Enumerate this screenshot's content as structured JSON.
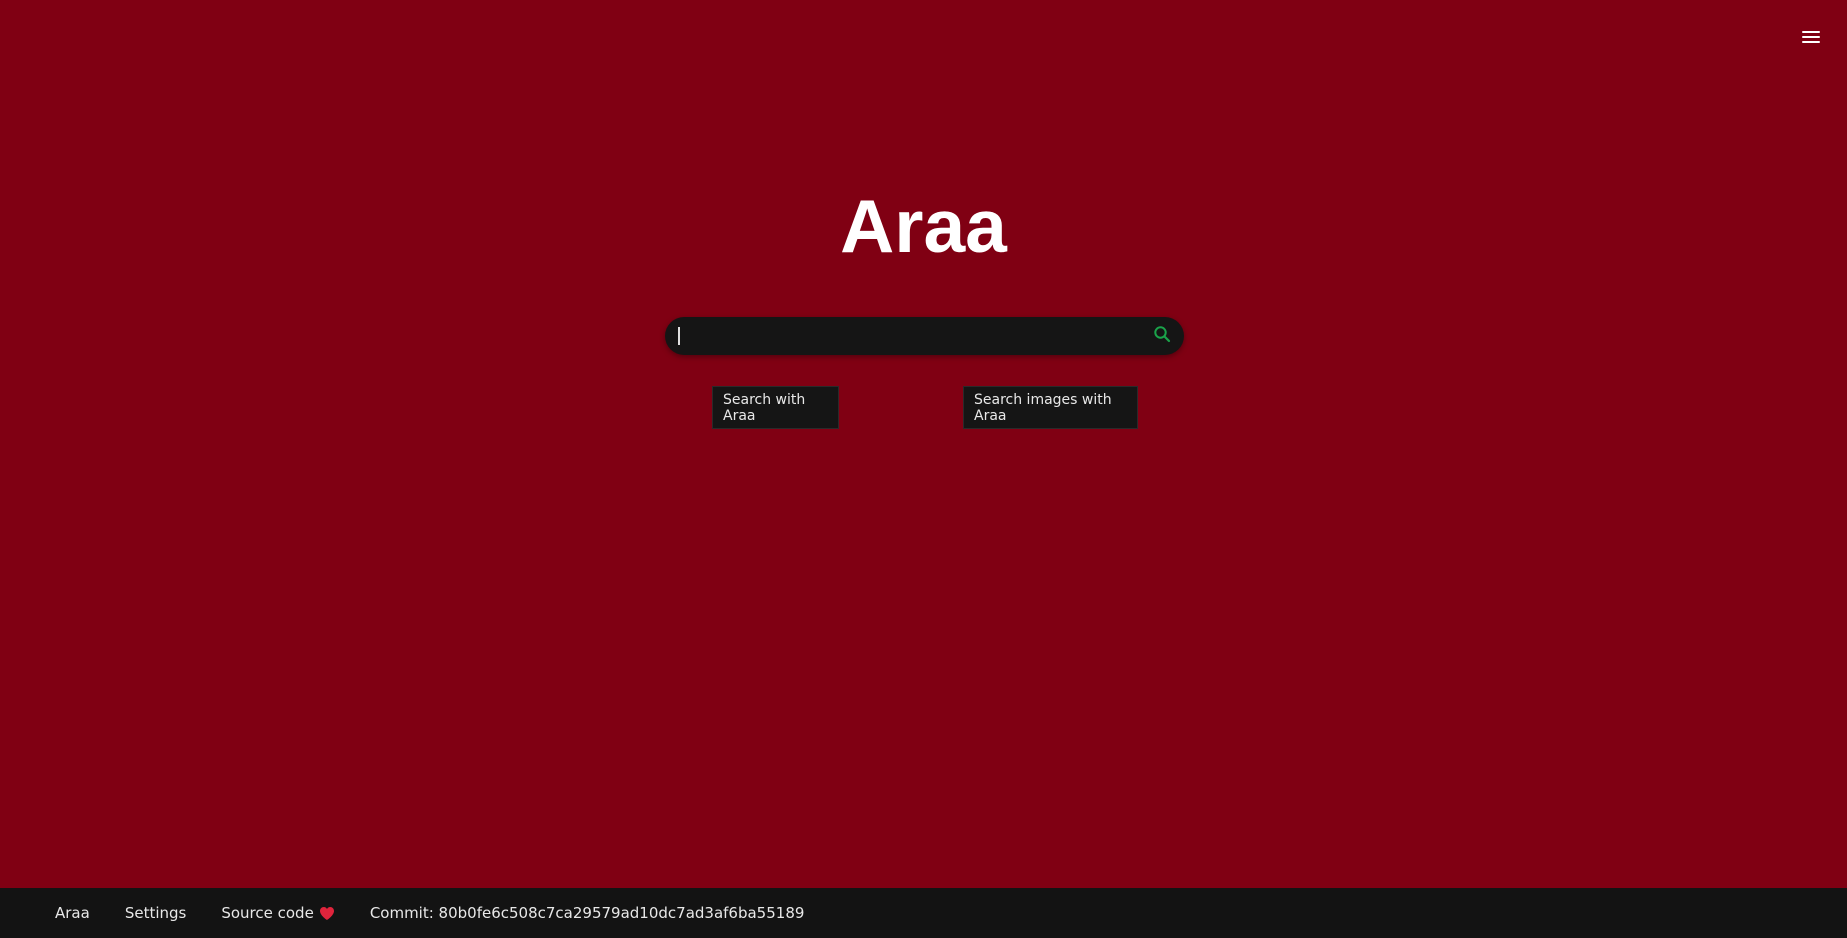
{
  "header": {
    "menu_icon": "hamburger-menu-icon"
  },
  "logo": {
    "text": "Araa"
  },
  "search": {
    "value": "",
    "placeholder": "",
    "icon": "search-icon",
    "icon_color": "#1aa34a"
  },
  "buttons": {
    "search_label": "Search with Araa",
    "images_label": "Search images with Araa"
  },
  "footer": {
    "home_label": "Araa",
    "settings_label": "Settings",
    "source_label": "Source code",
    "source_icon": "heart-icon",
    "commit_label": "Commit: 80b0fe6c508c7ca29579ad10dc7ad3af6ba55189"
  },
  "colors": {
    "background": "#800013",
    "surface": "#151515",
    "footer": "#131313",
    "heart": "#e0243c"
  }
}
